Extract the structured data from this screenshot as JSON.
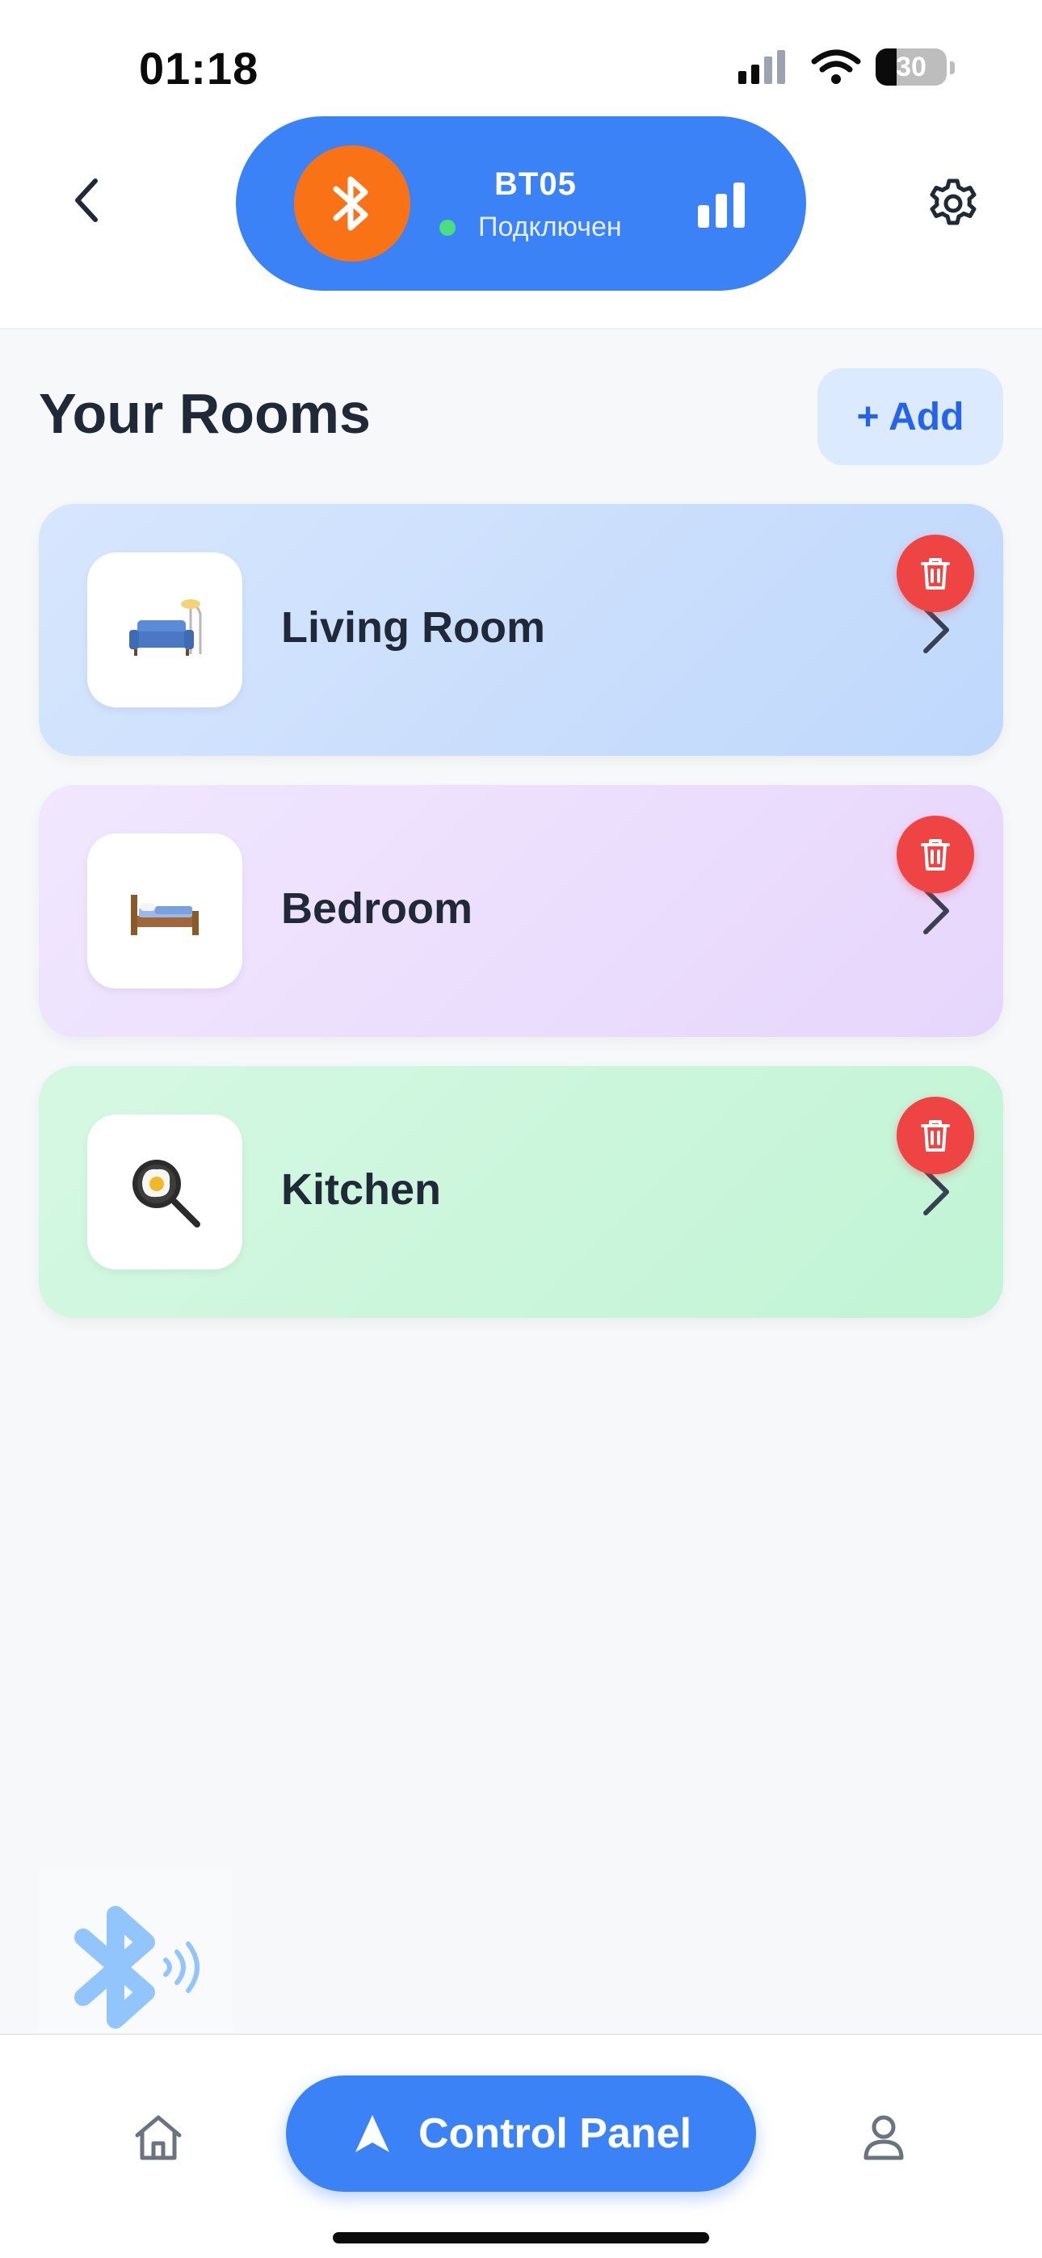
{
  "status_bar": {
    "time": "01:18",
    "battery": "30",
    "battery_level": 0.3
  },
  "header": {
    "back_icon": "chevron-left-icon",
    "settings_icon": "gear-icon",
    "device": {
      "name": "BT05",
      "status": "Подключен",
      "icon": "bluetooth-icon",
      "signal_icon": "signal-bars-icon",
      "colors": {
        "pill": "#3b82f6",
        "icon_circle": "#f97316",
        "status_dot": "#4ade80"
      }
    }
  },
  "main": {
    "title": "Your Rooms",
    "add_label": "+ Add",
    "rooms": [
      {
        "name": "Living Room",
        "icon": "sofa-icon",
        "theme": "blue"
      },
      {
        "name": "Bedroom",
        "icon": "bed-icon",
        "theme": "purple"
      },
      {
        "name": "Kitchen",
        "icon": "frying-pan-icon",
        "theme": "green"
      }
    ]
  },
  "bottom_nav": {
    "home_icon": "home-icon",
    "control_panel_label": "Control Panel",
    "control_panel_icon": "navigation-arrow-icon",
    "profile_icon": "user-icon"
  },
  "colors": {
    "accent": "#3b82f6",
    "danger": "#ef4444",
    "add_bg": "#dbeafe",
    "add_text": "#2563eb"
  }
}
